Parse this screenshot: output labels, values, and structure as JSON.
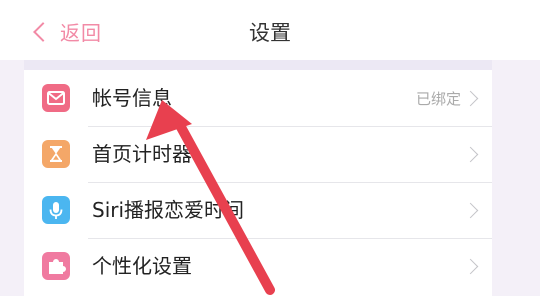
{
  "nav": {
    "back_label": "返回",
    "title": "设置"
  },
  "colors": {
    "accent": "#f28aa6",
    "annotation_arrow": "#e8404f"
  },
  "settings": [
    {
      "label": "帐号信息",
      "value": "已绑定",
      "icon": "mail-icon",
      "icon_color": "#f06b85"
    },
    {
      "label": "首页计时器",
      "value": "",
      "icon": "hourglass-icon",
      "icon_color": "#f4a768"
    },
    {
      "label": "Siri播报恋爱时间",
      "value": "",
      "icon": "microphone-icon",
      "icon_color": "#4bb6f0"
    },
    {
      "label": "个性化设置",
      "value": "",
      "icon": "puzzle-icon",
      "icon_color": "#f07aa0"
    }
  ]
}
